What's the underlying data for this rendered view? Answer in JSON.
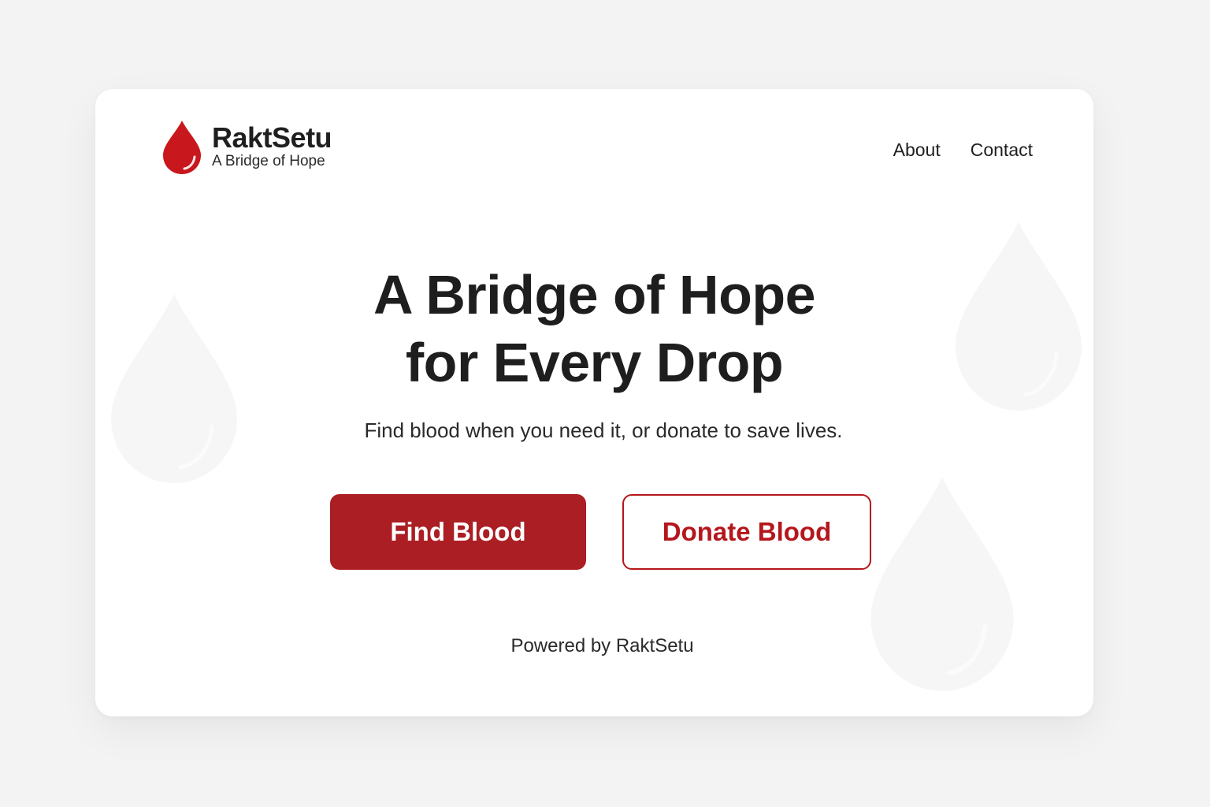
{
  "brand": {
    "name": "RaktSetu",
    "tagline": "A Bridge of Hope",
    "logo_icon": "blood-drop-icon",
    "accent_color": "#c8171d"
  },
  "nav": {
    "items": [
      {
        "label": "About"
      },
      {
        "label": "Contact"
      }
    ]
  },
  "hero": {
    "title_line1": "A Bridge of Hope",
    "title_line2": "for Every Drop",
    "subtitle": "Find blood when you need it, or donate to save lives."
  },
  "actions": {
    "find_label": "Find Blood",
    "find_color": "#ab1e23",
    "donate_label": "Donate Blood",
    "donate_color": "#b5161c"
  },
  "footer": {
    "text": "Powered by RaktSetu"
  },
  "decor": {
    "background_icon": "blood-drop-icon"
  }
}
